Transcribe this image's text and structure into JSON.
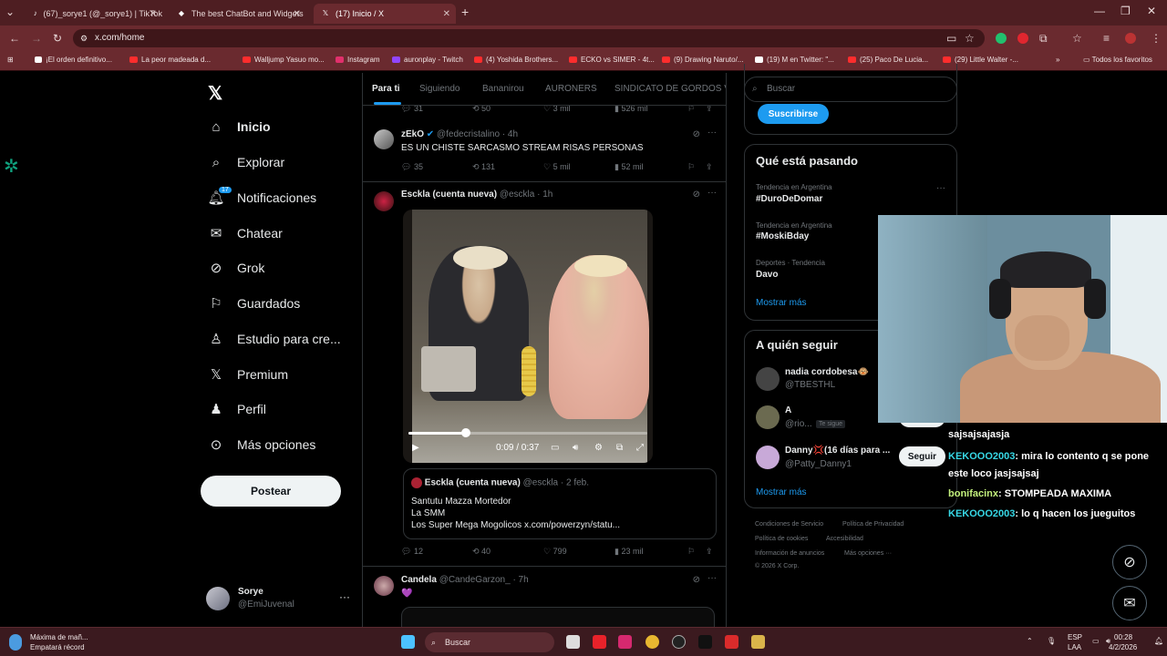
{
  "browser": {
    "tabs": [
      {
        "title": "(67)_sorye1 (@_sorye1) | TikTok"
      },
      {
        "title": "The best ChatBot and Widgets"
      },
      {
        "title": "(17) Inicio / X"
      }
    ],
    "url": "x.com/home",
    "bookmarks": [
      "¡El orden definitivo...",
      "La peor madeada d...",
      "Walljump Yasuo mo...",
      "Instagram",
      "auronplay - Twitch",
      "(4) Yoshida Brothers...",
      "ECKO vs SIMER - 4t...",
      "(9) Drawing Naruto/...",
      "(19) M en Twitter: \"...",
      "(25) Paco De Lucia...",
      "(29) Little Walter -..."
    ],
    "bookmarks_all": "Todos los favoritos"
  },
  "nav": {
    "items": [
      {
        "label": "Inicio"
      },
      {
        "label": "Explorar"
      },
      {
        "label": "Notificaciones",
        "badge": "17"
      },
      {
        "label": "Chatear"
      },
      {
        "label": "Grok"
      },
      {
        "label": "Guardados"
      },
      {
        "label": "Estudio para cre..."
      },
      {
        "label": "Premium"
      },
      {
        "label": "Perfil"
      },
      {
        "label": "Más opciones"
      }
    ],
    "post_button": "Postear",
    "profile": {
      "name": "Sorye",
      "handle": "@EmiJuvenal",
      "more": "···"
    }
  },
  "feed": {
    "tabs": [
      "Para ti",
      "Siguiendo",
      "Bananirou",
      "AURONERS",
      "SINDICATO DE GORDOS V"
    ],
    "top_actions": {
      "replies": "31",
      "reposts": "50",
      "likes": "3 mil",
      "views": "526 mil"
    },
    "posts": [
      {
        "name": "zEkO",
        "handle": "@fedecristalino · 4h",
        "text": "ES UN CHISTE SARCASMO STREAM RISAS PERSONAS",
        "replies": "35",
        "reposts": "131",
        "likes": "5 mil",
        "views": "52 mil"
      },
      {
        "name": "Esckla (cuenta nueva)",
        "handle": "@esckla · 1h",
        "video_time": "0:09 / 0:37",
        "video_progress_percent": 24,
        "quote": {
          "name": "Esckla (cuenta nueva)",
          "handle": "@esckla · 2 feb.",
          "lines": [
            "Santutu Mazza Mortedor",
            "La SMM",
            "Los Super Mega Mogolicos x.com/powerzyn/statu..."
          ]
        },
        "replies": "12",
        "reposts": "40",
        "likes": "799",
        "views": "23 mil"
      },
      {
        "name": "Candela",
        "handle": "@CandeGarzon_ · 7h",
        "text": "💜"
      }
    ]
  },
  "sidebar": {
    "search_placeholder": "Buscar",
    "subscribe": "Suscribirse",
    "trends_title": "Qué está pasando",
    "trends": [
      {
        "meta": "Tendencia en Argentina",
        "name": "#DuroDeDomar"
      },
      {
        "meta": "Tendencia en Argentina",
        "name": "#MoskiBday"
      },
      {
        "meta": "Deportes · Tendencia",
        "name": "Davo"
      }
    ],
    "show_more": "Mostrar más",
    "follow_title": "A quién seguir",
    "follow": [
      {
        "name": "nadia cordobesa🐵",
        "handle": "@TBESTHL"
      },
      {
        "name": "A",
        "handle": "@rio...",
        "tag": "Te sigue",
        "button": "Seguir"
      },
      {
        "name": "Danny💢(16 días para ...",
        "handle": "@Patty_Danny1",
        "button": "Seguir"
      }
    ],
    "footer": [
      "Condiciones de Servicio",
      "Política de Privacidad",
      "Política de cookies",
      "Accesibilidad",
      "Información de anuncios",
      "Más opciones ···",
      "© 2026 X Corp."
    ]
  },
  "chat_overlay": {
    "lines": [
      {
        "user": "",
        "text": "sajsajsajasja"
      },
      {
        "user": "KEKOOO2003",
        "text": ": mira lo contento q se pone este loco jasjsajsaj"
      },
      {
        "user": "bonifacinx",
        "text": ": STOMPEADA MAXIMA"
      },
      {
        "user": "KEKOOO2003",
        "text": ": lo q hacen los jueguitos"
      }
    ]
  },
  "taskbar": {
    "weather_title": "Máxima de mañ...",
    "weather_sub": "Empatará récord",
    "search": "Buscar",
    "lang1": "ESP",
    "lang2": "LAA",
    "time": "00:28",
    "date": "4/2/2026"
  }
}
